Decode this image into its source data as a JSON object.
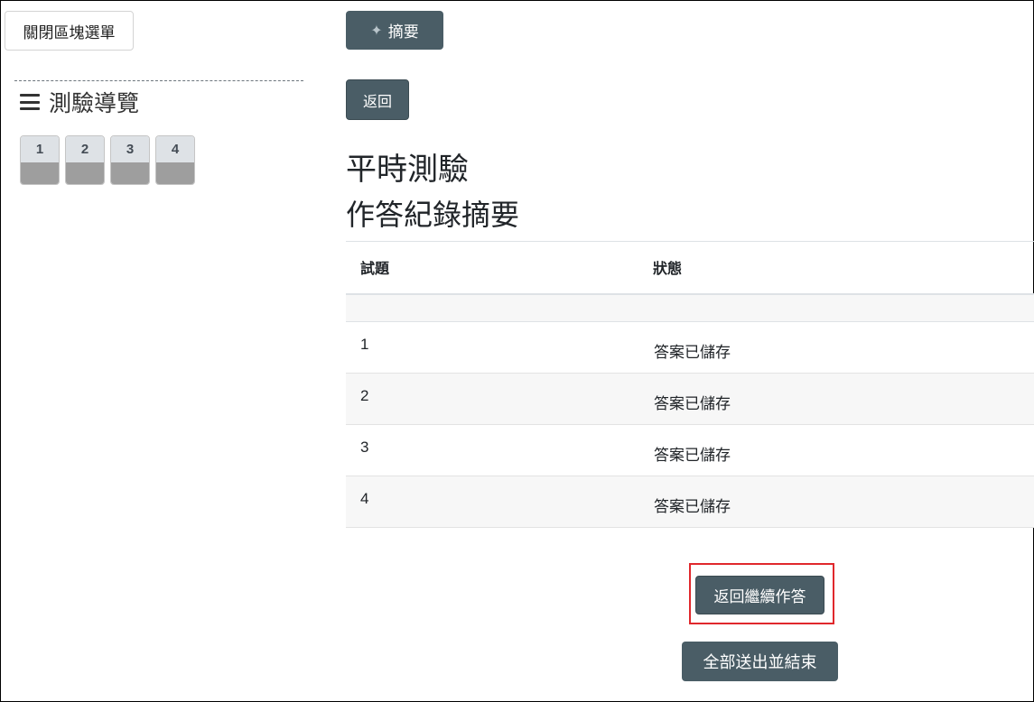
{
  "sidebar": {
    "close_block_label": "關閉區塊選單",
    "nav_title": "測驗導覽",
    "questions": [
      {
        "number": "1"
      },
      {
        "number": "2"
      },
      {
        "number": "3"
      },
      {
        "number": "4"
      }
    ]
  },
  "toolbar": {
    "summary_label": "摘要",
    "summary_icon": "sparkle-icon",
    "back_label": "返回"
  },
  "main": {
    "quiz_title": "平時測驗",
    "section_title": "作答紀錄摘要",
    "table": {
      "headers": [
        "試題",
        "狀態"
      ],
      "rows": [
        {
          "question": "1",
          "status": "答案已儲存"
        },
        {
          "question": "2",
          "status": "答案已儲存"
        },
        {
          "question": "3",
          "status": "答案已儲存"
        },
        {
          "question": "4",
          "status": "答案已儲存"
        }
      ]
    },
    "continue_label": "返回繼續作答",
    "submit_label": "全部送出並結束"
  },
  "colors": {
    "button_dark": "#4a5d66",
    "highlight": "#e0282c",
    "question_unanswered": "#9e9e9e"
  }
}
